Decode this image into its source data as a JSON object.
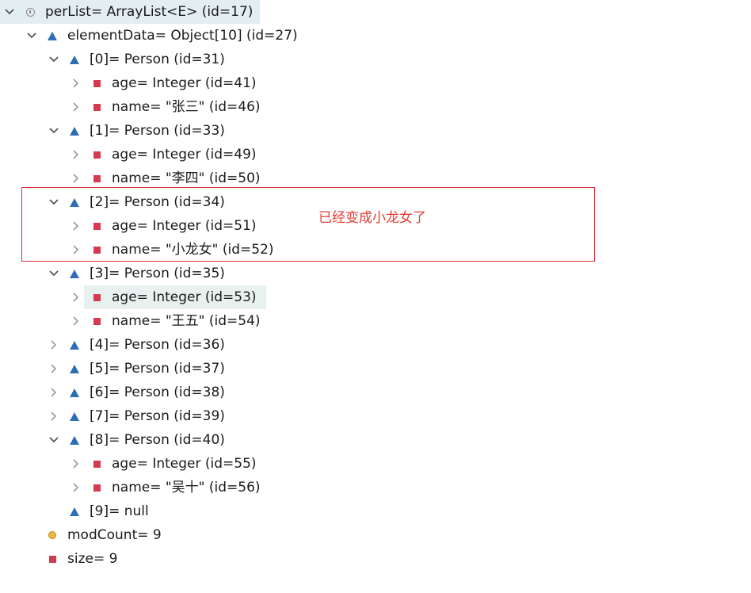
{
  "tree": [
    {
      "id": "perList",
      "label": "perList= ArrayList<E>  (id=17)",
      "icon": "object-icon",
      "twisty": "expanded",
      "depth": 0,
      "state": "selected"
    },
    {
      "id": "elementData",
      "label": "elementData= Object[10]  (id=27)",
      "icon": "protected-field-icon",
      "twisty": "expanded",
      "depth": 1
    },
    {
      "id": "item0",
      "label": "[0]= Person  (id=31)",
      "icon": "protected-field-icon",
      "twisty": "expanded",
      "depth": 2
    },
    {
      "id": "item0-age",
      "label": "age= Integer  (id=41)",
      "icon": "private-field-icon",
      "twisty": "collapsed",
      "depth": 3
    },
    {
      "id": "item0-name",
      "label": "name= \"张三\" (id=46)",
      "icon": "private-field-icon",
      "twisty": "collapsed",
      "depth": 3
    },
    {
      "id": "item1",
      "label": "[1]= Person  (id=33)",
      "icon": "protected-field-icon",
      "twisty": "expanded",
      "depth": 2
    },
    {
      "id": "item1-age",
      "label": "age= Integer  (id=49)",
      "icon": "private-field-icon",
      "twisty": "collapsed",
      "depth": 3
    },
    {
      "id": "item1-name",
      "label": "name= \"李四\" (id=50)",
      "icon": "private-field-icon",
      "twisty": "collapsed",
      "depth": 3
    },
    {
      "id": "item2",
      "label": "[2]= Person  (id=34)",
      "icon": "protected-field-icon",
      "twisty": "expanded",
      "depth": 2
    },
    {
      "id": "item2-age",
      "label": "age= Integer  (id=51)",
      "icon": "private-field-icon",
      "twisty": "collapsed",
      "depth": 3
    },
    {
      "id": "item2-name",
      "label": "name= \"小龙女\" (id=52)",
      "icon": "private-field-icon",
      "twisty": "collapsed",
      "depth": 3
    },
    {
      "id": "item3",
      "label": "[3]= Person  (id=35)",
      "icon": "protected-field-icon",
      "twisty": "expanded",
      "depth": 2
    },
    {
      "id": "item3-age",
      "label": "age= Integer  (id=53)",
      "icon": "private-field-icon",
      "twisty": "collapsed",
      "depth": 3,
      "state": "highlighted"
    },
    {
      "id": "item3-name",
      "label": "name= \"王五\" (id=54)",
      "icon": "private-field-icon",
      "twisty": "collapsed",
      "depth": 3
    },
    {
      "id": "item4",
      "label": "[4]= Person  (id=36)",
      "icon": "protected-field-icon",
      "twisty": "collapsed",
      "depth": 2
    },
    {
      "id": "item5",
      "label": "[5]= Person  (id=37)",
      "icon": "protected-field-icon",
      "twisty": "collapsed",
      "depth": 2
    },
    {
      "id": "item6",
      "label": "[6]= Person  (id=38)",
      "icon": "protected-field-icon",
      "twisty": "collapsed",
      "depth": 2
    },
    {
      "id": "item7",
      "label": "[7]= Person  (id=39)",
      "icon": "protected-field-icon",
      "twisty": "collapsed",
      "depth": 2
    },
    {
      "id": "item8",
      "label": "[8]= Person  (id=40)",
      "icon": "protected-field-icon",
      "twisty": "expanded",
      "depth": 2
    },
    {
      "id": "item8-age",
      "label": "age= Integer  (id=55)",
      "icon": "private-field-icon",
      "twisty": "collapsed",
      "depth": 3
    },
    {
      "id": "item8-name",
      "label": "name= \"吴十\" (id=56)",
      "icon": "private-field-icon",
      "twisty": "collapsed",
      "depth": 3
    },
    {
      "id": "item9",
      "label": "[9]= null",
      "icon": "protected-field-icon",
      "twisty": "none",
      "depth": 2
    },
    {
      "id": "modCount",
      "label": "modCount= 9",
      "icon": "package-field-icon",
      "twisty": "none",
      "depth": 1
    },
    {
      "id": "size",
      "label": "size= 9",
      "icon": "private-field-icon",
      "twisty": "none",
      "depth": 1
    }
  ],
  "annotation": {
    "text": "已经变成小龙女了",
    "color": "#e63c34"
  },
  "colors": {
    "selection": "#e3eef3",
    "triangle_icon": "#2f6db5",
    "square_icon": "#d63a4f",
    "annotation_border": "#e0303c"
  }
}
